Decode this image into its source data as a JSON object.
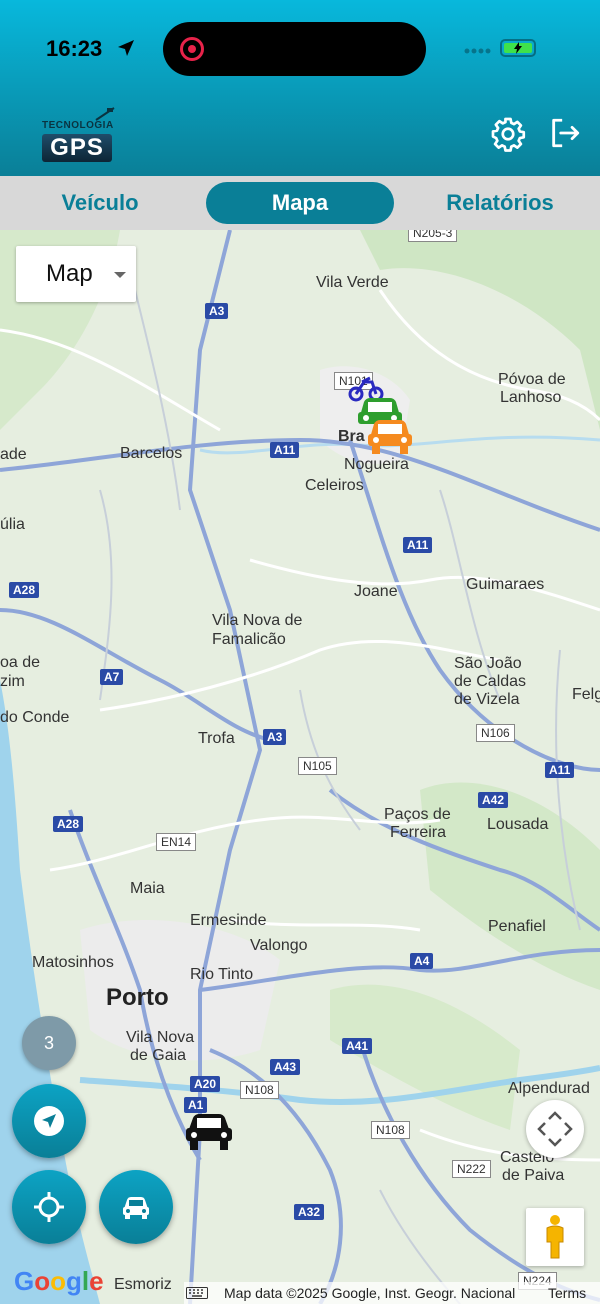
{
  "status_bar": {
    "time": "16:23"
  },
  "header": {
    "logo_top": "TECNOLOGIA",
    "logo_main": "GPS"
  },
  "tabs": [
    {
      "label": "Veículo",
      "active": false
    },
    {
      "label": "Mapa",
      "active": true
    },
    {
      "label": "Relatórios",
      "active": false
    }
  ],
  "map": {
    "type_selector": "Map",
    "cluster_count": "3",
    "places": {
      "vila_verde": "Vila Verde",
      "povoa_de": "Póvoa de",
      "lanhoso": "Lanhoso",
      "barcelos": "Barcelos",
      "bra": "Bra",
      "nogueira": "Nogueira",
      "celeiros": "Celeiros",
      "ade": "ade",
      "ulia": "úlia",
      "joane": "Joane",
      "guimaraes": "Guimaraes",
      "vila_nova_de": "Vila Nova de",
      "famalicao": "Famalicão",
      "sao_joao": "São João",
      "de_caldas": "de Caldas",
      "de_vizela": "de Vizela",
      "fel": "Felg",
      "oa_de": "oa de",
      "zim": "zim",
      "do_conde": "do Conde",
      "trofa": "Trofa",
      "pacos_de": "Paços de",
      "ferreira": "Ferreira",
      "lousada": "Lousada",
      "maia": "Maia",
      "ermesinde": "Ermesinde",
      "valongo": "Valongo",
      "penafiel": "Penafiel",
      "matosinhos": "Matosinhos",
      "rio_tinto": "Rio Tinto",
      "porto": "Porto",
      "vila_nova_de_2": "Vila Nova",
      "de_gaia": "de Gaia",
      "alpendurada": "Alpendurad",
      "castelo": "Castelo",
      "de_paiva": "de Paiva",
      "esmoriz": "Esmoriz"
    },
    "roads": {
      "a3_top": "A3",
      "n101": "N101",
      "a11_a": "A11",
      "a11_b": "A11",
      "a28_a": "A28",
      "a7": "A7",
      "a3_mid": "A3",
      "n105": "N105",
      "n106": "N106",
      "a11_c": "A11",
      "a28_b": "A28",
      "en14": "EN14",
      "a42": "A42",
      "a4": "A4",
      "a41": "A41",
      "a43": "A43",
      "a20": "A20",
      "n108_a": "N108",
      "a1": "A1",
      "n108_b": "N108",
      "n222": "N222",
      "a32": "A32",
      "n224": "N224",
      "n205": "N205-3"
    },
    "google_logo": "Google",
    "attribution": "Map data ©2025 Google, Inst. Geogr. Nacional",
    "terms": "Terms"
  },
  "colors": {
    "header_top": "#08b8dc",
    "header_bottom": "#0a7f97",
    "accent": "#0a7f97",
    "vehicle_green": "#2e9e2e",
    "vehicle_orange": "#f58a1f",
    "vehicle_blue": "#2a2ac0"
  }
}
